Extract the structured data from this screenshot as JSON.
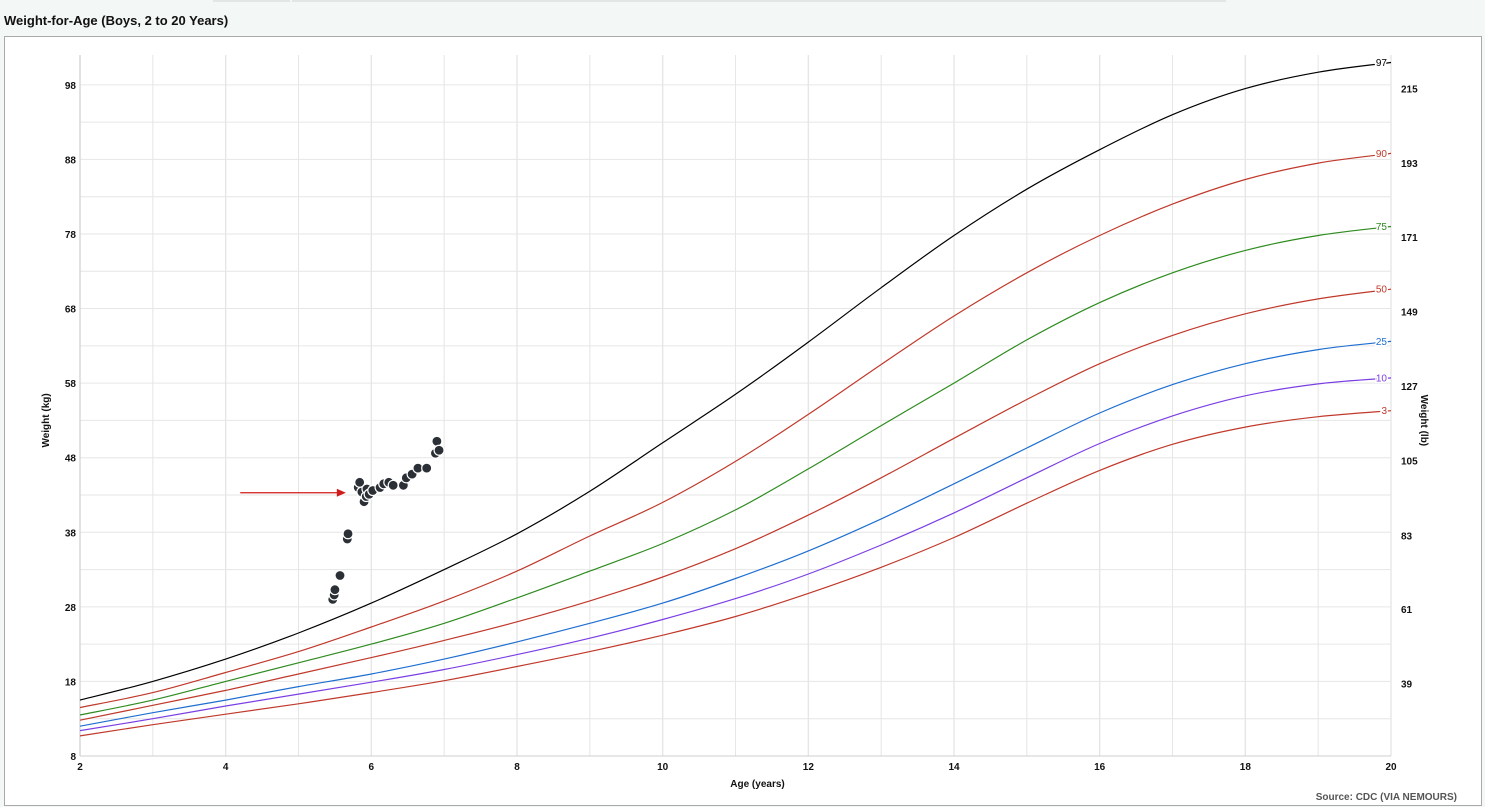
{
  "page": {
    "title": "Weight-for-Age (Boys, 2 to 20 Years)",
    "source": "Source: CDC (VIA NEMOURS)"
  },
  "chart_data": {
    "type": "line",
    "title": "Weight-for-Age (Boys, 2 to 20 Years)",
    "xlabel": "Age (years)",
    "ylabel": "Weight (kg)",
    "ylabel_right": "Weight (lb)",
    "xlim": [
      2,
      20
    ],
    "ylim": [
      8,
      102
    ],
    "grid": true,
    "x_ticks": [
      2,
      4,
      6,
      8,
      10,
      12,
      14,
      16,
      18,
      20
    ],
    "y_ticks": [
      8,
      18,
      28,
      38,
      48,
      58,
      68,
      78,
      88,
      98
    ],
    "y_ticks_right": [
      {
        "kg": 17.7,
        "label": "39"
      },
      {
        "kg": 27.7,
        "label": "61"
      },
      {
        "kg": 37.6,
        "label": "83"
      },
      {
        "kg": 47.6,
        "label": "105"
      },
      {
        "kg": 57.6,
        "label": "127"
      },
      {
        "kg": 67.6,
        "label": "149"
      },
      {
        "kg": 77.6,
        "label": "171"
      },
      {
        "kg": 87.5,
        "label": "193"
      },
      {
        "kg": 97.5,
        "label": "215"
      }
    ],
    "x_samples": [
      2,
      3,
      4,
      5,
      6,
      7,
      8,
      9,
      10,
      11,
      12,
      13,
      14,
      15,
      16,
      17,
      18,
      19,
      20
    ],
    "series": [
      {
        "name": "97",
        "color": "#000000",
        "values": [
          15.5,
          18.0,
          21.0,
          24.5,
          28.5,
          33.0,
          37.8,
          43.5,
          50.0,
          56.5,
          63.5,
          70.8,
          77.8,
          84.0,
          89.3,
          94.0,
          97.5,
          99.7,
          101.0
        ]
      },
      {
        "name": "90",
        "color": "#c0392b",
        "values": [
          14.5,
          16.5,
          19.2,
          22.0,
          25.3,
          28.8,
          32.8,
          37.5,
          42.0,
          47.5,
          53.8,
          60.5,
          67.0,
          72.8,
          77.8,
          82.0,
          85.3,
          87.5,
          88.8
        ]
      },
      {
        "name": "75",
        "color": "#2e8b1f",
        "values": [
          13.5,
          15.5,
          18.0,
          20.5,
          23.0,
          25.8,
          29.2,
          32.8,
          36.5,
          41.0,
          46.5,
          52.3,
          58.0,
          63.8,
          68.8,
          72.8,
          75.8,
          77.8,
          79.0
        ]
      },
      {
        "name": "50",
        "color": "#c0392b",
        "values": [
          12.8,
          14.8,
          16.8,
          19.0,
          21.2,
          23.5,
          26.0,
          28.8,
          32.0,
          35.8,
          40.3,
          45.3,
          50.6,
          55.8,
          60.6,
          64.4,
          67.3,
          69.3,
          70.6
        ]
      },
      {
        "name": "25",
        "color": "#1f6fd1",
        "values": [
          12.0,
          13.8,
          15.5,
          17.3,
          19.0,
          21.0,
          23.3,
          25.8,
          28.5,
          31.8,
          35.5,
          39.8,
          44.5,
          49.3,
          54.0,
          57.8,
          60.6,
          62.5,
          63.6
        ]
      },
      {
        "name": "10",
        "color": "#7b3fe4",
        "values": [
          11.4,
          13.0,
          14.7,
          16.3,
          17.9,
          19.6,
          21.6,
          23.8,
          26.3,
          29.1,
          32.4,
          36.3,
          40.6,
          45.3,
          49.9,
          53.6,
          56.3,
          57.9,
          58.7
        ]
      },
      {
        "name": "3",
        "color": "#c0392b",
        "values": [
          10.7,
          12.2,
          13.6,
          15.0,
          16.5,
          18.1,
          20.0,
          22.0,
          24.2,
          26.7,
          29.8,
          33.3,
          37.3,
          41.9,
          46.3,
          49.8,
          52.1,
          53.5,
          54.3
        ]
      }
    ],
    "points": {
      "name": "Measurements",
      "color": "#2b2f36",
      "data": [
        {
          "x": 5.47,
          "y": 29.0
        },
        {
          "x": 5.49,
          "y": 29.6
        },
        {
          "x": 5.5,
          "y": 30.3
        },
        {
          "x": 5.57,
          "y": 32.2
        },
        {
          "x": 5.67,
          "y": 37.1
        },
        {
          "x": 5.68,
          "y": 37.8
        },
        {
          "x": 5.82,
          "y": 44.0
        },
        {
          "x": 5.84,
          "y": 44.7
        },
        {
          "x": 5.87,
          "y": 43.4
        },
        {
          "x": 5.9,
          "y": 42.1
        },
        {
          "x": 5.93,
          "y": 42.8
        },
        {
          "x": 5.94,
          "y": 43.8
        },
        {
          "x": 5.97,
          "y": 43.1
        },
        {
          "x": 6.02,
          "y": 43.6
        },
        {
          "x": 6.12,
          "y": 44.0
        },
        {
          "x": 6.17,
          "y": 44.5
        },
        {
          "x": 6.24,
          "y": 44.7
        },
        {
          "x": 6.3,
          "y": 44.3
        },
        {
          "x": 6.44,
          "y": 44.3
        },
        {
          "x": 6.48,
          "y": 45.3
        },
        {
          "x": 6.56,
          "y": 45.8
        },
        {
          "x": 6.64,
          "y": 46.6
        },
        {
          "x": 6.76,
          "y": 46.6
        },
        {
          "x": 6.88,
          "y": 48.6
        },
        {
          "x": 6.9,
          "y": 50.2
        },
        {
          "x": 6.93,
          "y": 49.0
        }
      ]
    },
    "annotation": {
      "type": "arrow",
      "color": "#d11a1a",
      "from": {
        "x": 4.2,
        "y": 43.3
      },
      "to": {
        "x": 5.65,
        "y": 43.3
      }
    }
  }
}
